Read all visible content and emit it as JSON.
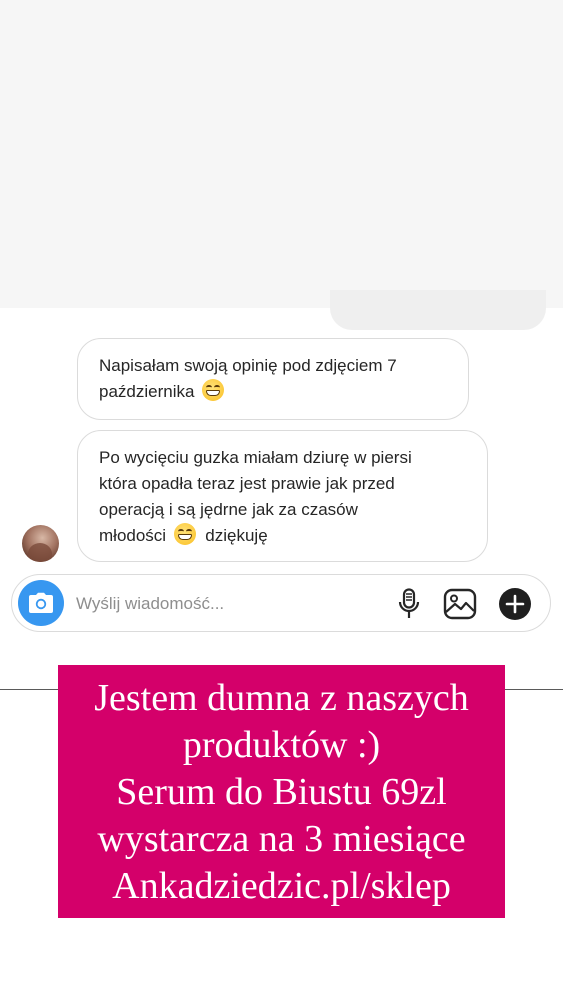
{
  "chat": {
    "messages": [
      {
        "lines": [
          "Napisałam swoją opinię pod zdjęciem 7",
          "października"
        ],
        "emoji": "grinning-face-emoji"
      },
      {
        "lines": [
          "Po wycięciu guzka miałam dziurę w piersi",
          "która opadła teraz jest prawie jak przed",
          "operacją i są jędrne jak za czasów",
          "młodości"
        ],
        "emoji": "grinning-face-emoji",
        "suffix": "dziękuję"
      }
    ]
  },
  "composer": {
    "placeholder": "Wyślij wiadomość...",
    "accent_color": "#3797f0",
    "icons": [
      "camera-icon",
      "microphone-icon",
      "gallery-icon",
      "plus-icon"
    ]
  },
  "promo": {
    "lines": [
      "Jestem dumna z naszych",
      "produktów :)",
      "Serum do Biustu 69zl",
      "wystarcza na 3 miesiące",
      "Ankadziedzic.pl/sklep"
    ],
    "background_color": "#d4006a"
  }
}
